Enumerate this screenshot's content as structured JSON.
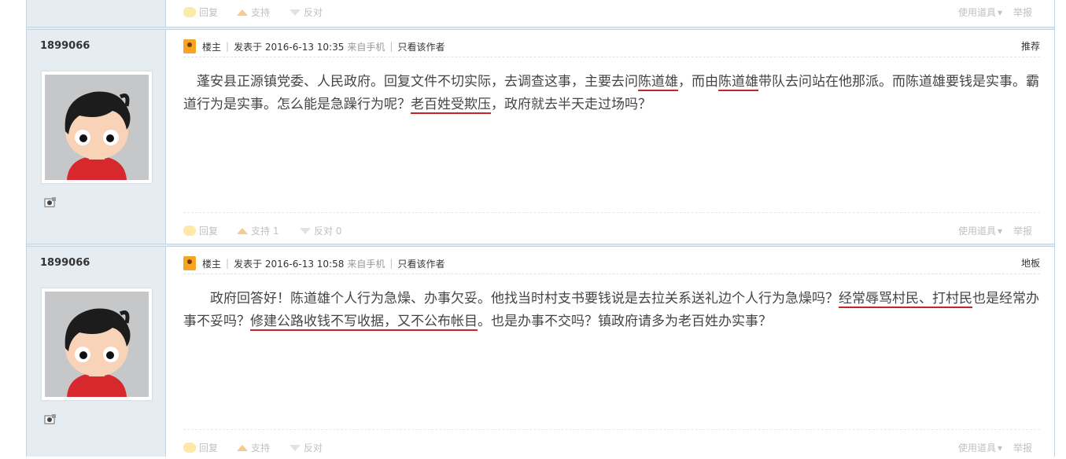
{
  "actions": {
    "reply": "回复",
    "support": "支持",
    "oppose": "反对",
    "use_tool": "使用道具",
    "tool_arrow": "▾",
    "report": "举报"
  },
  "posts": [
    {
      "author": "1899066",
      "owner_tag": "楼主",
      "posted_at": "发表于 2016-6-13 10:35",
      "from": "来自手机",
      "only_author": "只看该作者",
      "floor": "推荐",
      "content_parts": [
        "　蓬安县正源镇党委、人民政府。回复文件不切实际，去调查这事，主要去问",
        "陈道雄",
        "，而由",
        "陈道雄",
        "带队去问站在他那派。而陈道雄要钱是实事。霸道行为是实事。怎么能是急躁行为呢？",
        "老百姓受欺压",
        "，政府就去半天走过场吗？"
      ],
      "support_label": "支持 1",
      "oppose_label": "反对 0"
    },
    {
      "author": "1899066",
      "owner_tag": "楼主",
      "posted_at": "发表于 2016-6-13 10:58",
      "from": "来自手机",
      "only_author": "只看该作者",
      "floor": "地板",
      "content_parts": [
        "　　政府回答好！陈道雄个人行为急燥、办事欠妥。他找当时村支书要钱说是去拉关系送礼边个人行为急燥吗？",
        "经常辱骂村民、打村民",
        "也是经常办事不妥吗？",
        "修建公路收钱不写收据，又不公布帐目",
        "。也是办事不交吗？镇政府请多为老百姓办实事？"
      ],
      "support_label": "支持",
      "oppose_label": "反对"
    }
  ]
}
